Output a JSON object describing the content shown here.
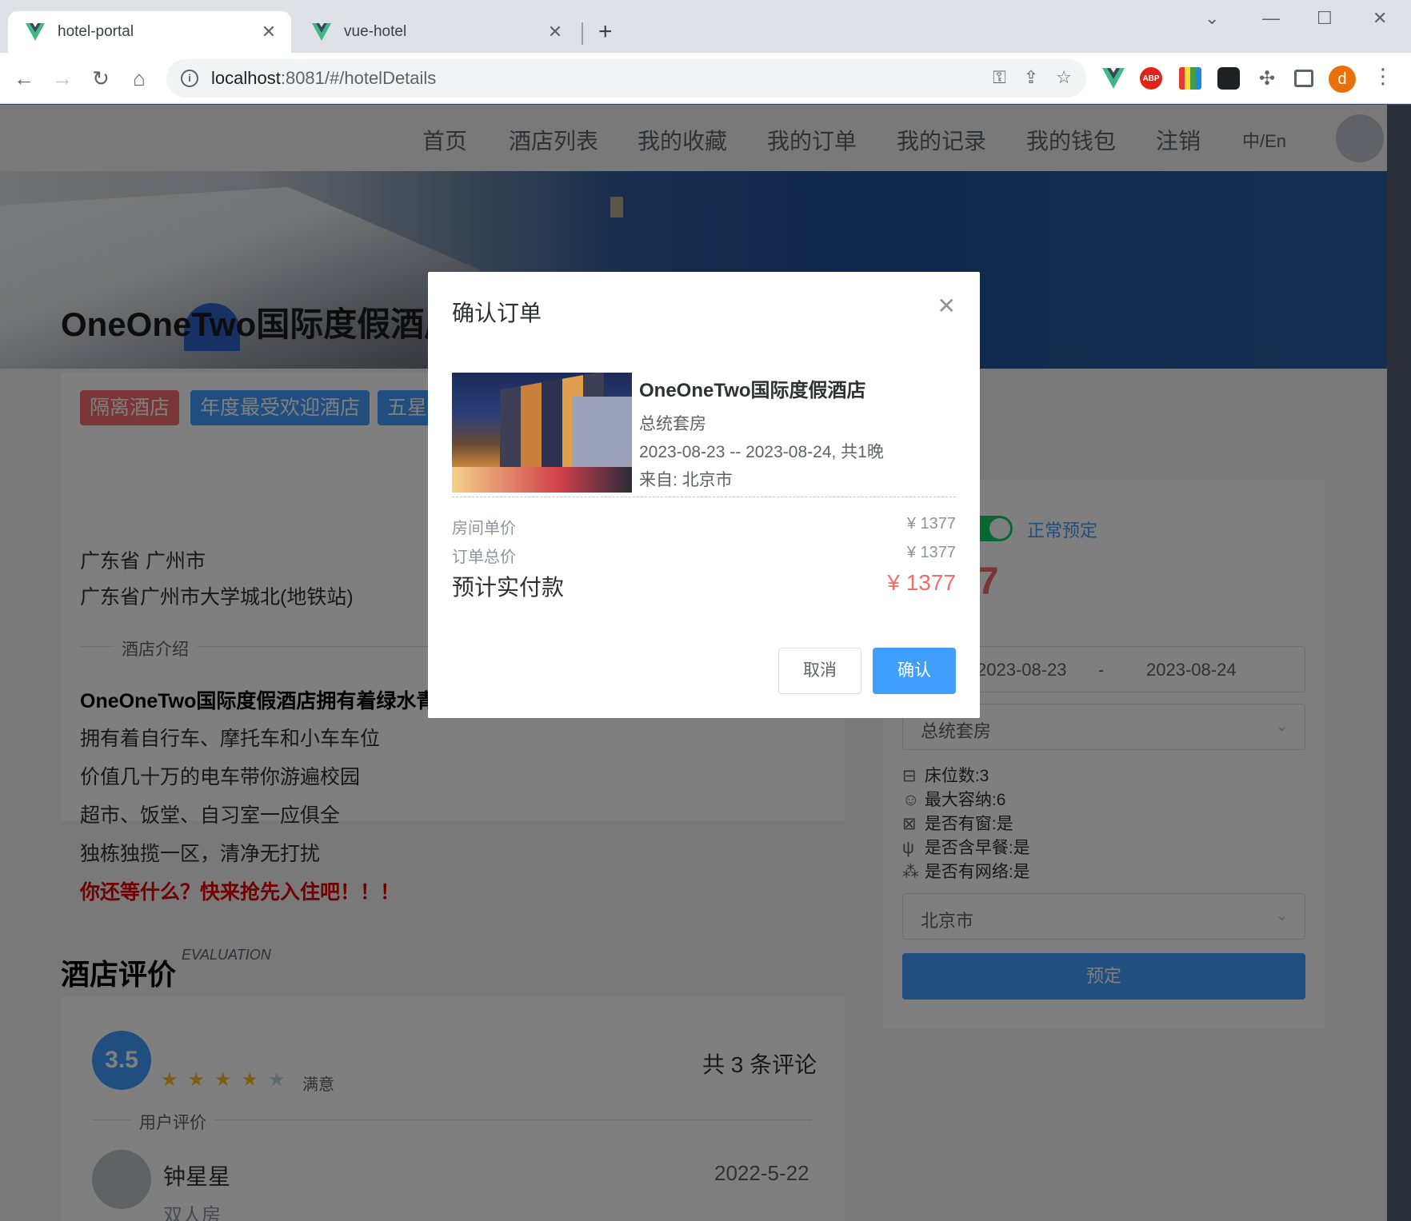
{
  "browser": {
    "tabs": [
      {
        "title": "hotel-portal"
      },
      {
        "title": "vue-hotel"
      }
    ],
    "url_host": "localhost",
    "url_path": ":8081/#/hotelDetails",
    "profile_initial": "d",
    "abp_label": "ABP"
  },
  "nav": {
    "items": [
      "首页",
      "酒店列表",
      "我的收藏",
      "我的订单",
      "我的记录",
      "我的钱包",
      "注销"
    ],
    "lang": "中/En"
  },
  "hotel": {
    "title": "OneOneTwo国际度假酒店",
    "tags": [
      "隔离酒店",
      "年度最受欢迎酒店",
      "五星级酒店"
    ],
    "province_city": "广东省 广州市",
    "address": "广东省广州市大学城北(地铁站)",
    "intro_heading": "酒店介绍",
    "intro_lines": [
      "OneOneTwo国际度假酒店拥有着绿水青山",
      "拥有着自行车、摩托车和小车车位",
      "价值几十万的电车带你游遍校园",
      "超市、饭堂、自习室一应俱全",
      "独栋独揽一区，清净无打扰",
      "你还等什么？快来抢先入住吧！！！"
    ]
  },
  "booking": {
    "switch_label": "正常预定",
    "price_display": "7",
    "date_start": "2023-08-23",
    "date_sep": "-",
    "date_end": "2023-08-24",
    "room_type": "总统套房",
    "room_info": [
      {
        "icon": "bed-icon",
        "glyph": "⊟",
        "text": "床位数:3"
      },
      {
        "icon": "user-icon",
        "glyph": "☺",
        "text": "最大容纳:6"
      },
      {
        "icon": "window-icon",
        "glyph": "⊠",
        "text": "是否有窗:是"
      },
      {
        "icon": "fork-knife-icon",
        "glyph": "ψ",
        "text": "是否含早餐:是"
      },
      {
        "icon": "wifi-icon",
        "glyph": "⁂",
        "text": "是否有网络:是"
      }
    ],
    "city": "北京市",
    "book_label": "预定"
  },
  "evaluation": {
    "title": "酒店评价",
    "title_en": "EVALUATION",
    "score": "3.5",
    "rating": 3.5,
    "rating_text": "满意",
    "count_text": "共 3 条评论",
    "section_label": "用户评价",
    "review": {
      "user": "钟星星",
      "date": "2022-5-22",
      "room": "双人房"
    }
  },
  "dialog": {
    "title": "确认订单",
    "hotel_name": "OneOneTwo国际度假酒店",
    "room_type": "总统套房",
    "dates": "2023-08-23 -- 2023-08-24, 共1晚",
    "from": "来自: 北京市",
    "unit_price_label": "房间单价",
    "unit_price": "¥ 1377",
    "total_label": "订单总价",
    "total": "¥ 1377",
    "pay_label": "预计实付款",
    "pay": "¥ 1377",
    "cancel_label": "取消",
    "confirm_label": "确认"
  },
  "colors": {
    "primary": "#409eff",
    "danger": "#f56c6c",
    "success": "#13ce66",
    "vue_green": "#41b883"
  }
}
